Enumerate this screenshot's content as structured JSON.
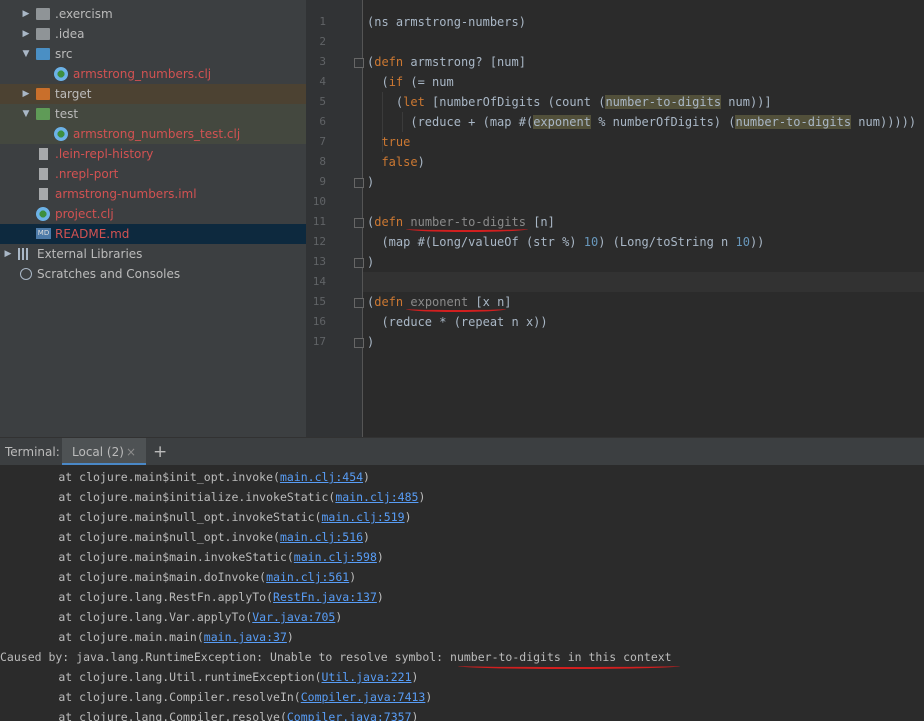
{
  "project_tree": {
    "items": [
      {
        "label": ".exercism",
        "type": "folder",
        "expanded": false
      },
      {
        "label": ".idea",
        "type": "folder",
        "expanded": false
      },
      {
        "label": "src",
        "type": "folder",
        "expanded": true
      },
      {
        "label": "armstrong_numbers.clj",
        "type": "clj"
      },
      {
        "label": "target",
        "type": "folder",
        "expanded": false
      },
      {
        "label": "test",
        "type": "folder",
        "expanded": true
      },
      {
        "label": "armstrong_numbers_test.clj",
        "type": "clj"
      },
      {
        "label": ".lein-repl-history",
        "type": "file"
      },
      {
        "label": ".nrepl-port",
        "type": "file"
      },
      {
        "label": "armstrong-numbers.iml",
        "type": "file"
      },
      {
        "label": "project.clj",
        "type": "clj"
      },
      {
        "label": "README.md",
        "type": "md"
      },
      {
        "label": "External Libraries",
        "type": "libraries"
      },
      {
        "label": "Scratches and Consoles",
        "type": "scratches"
      }
    ]
  },
  "editor": {
    "line_numbers": [
      "1",
      "2",
      "3",
      "4",
      "5",
      "6",
      "7",
      "8",
      "9",
      "10",
      "11",
      "12",
      "13",
      "14",
      "15",
      "16",
      "17"
    ],
    "line1": "(ns armstrong-numbers)",
    "line3": {
      "a": "(",
      "defn": "defn",
      "b": " armstrong? [num]"
    },
    "line4": {
      "a": "(",
      "if": "if",
      "b": " (= num"
    },
    "line5": {
      "a": "(",
      "let": "let",
      "b": " [numberOfDigits (count (",
      "fn": "number-to-digits",
      "c": " num))]"
    },
    "line6": {
      "a": "(reduce + (map #(",
      "fn1": "exponent",
      "b": " % numberOfDigits) (",
      "fn2": "number-to-digits",
      "c": " num)))))"
    },
    "line7": "true",
    "line8": {
      "kw": "false",
      "b": ")"
    },
    "line9": ")",
    "line11": {
      "a": "(",
      "defn": "defn",
      "sp": " ",
      "name": "number-to-digits",
      "b": " [n]"
    },
    "line12": {
      "a": "(map #(Long/valueOf (str %) ",
      "n1": "10",
      "b": ") (Long/toString n ",
      "n2": "10",
      "c": "))"
    },
    "line13": ")",
    "line15": {
      "a": "(",
      "defn": "defn",
      "sp": " ",
      "name": "exponent",
      "b": " [x n]"
    },
    "line16": {
      "a": "(reduce * (repeat n x))"
    },
    "line17": ")"
  },
  "terminal": {
    "title": "Terminal:",
    "tab_label": "Local (2)",
    "close_glyph": "×",
    "add_glyph": "+",
    "lines": [
      {
        "prefix": "        at clojure.main$init_opt.invoke(",
        "link": "main.clj:454",
        "suffix": ")"
      },
      {
        "prefix": "        at clojure.main$initialize.invokeStatic(",
        "link": "main.clj:485",
        "suffix": ")"
      },
      {
        "prefix": "        at clojure.main$null_opt.invokeStatic(",
        "link": "main.clj:519",
        "suffix": ")"
      },
      {
        "prefix": "        at clojure.main$null_opt.invoke(",
        "link": "main.clj:516",
        "suffix": ")"
      },
      {
        "prefix": "        at clojure.main$main.invokeStatic(",
        "link": "main.clj:598",
        "suffix": ")"
      },
      {
        "prefix": "        at clojure.main$main.doInvoke(",
        "link": "main.clj:561",
        "suffix": ")"
      },
      {
        "prefix": "        at clojure.lang.RestFn.applyTo(",
        "link": "RestFn.java:137",
        "suffix": ")"
      },
      {
        "prefix": "        at clojure.lang.Var.applyTo(",
        "link": "Var.java:705",
        "suffix": ")"
      },
      {
        "prefix": "        at clojure.main.main(",
        "link": "main.java:37",
        "suffix": ")"
      },
      {
        "prefix": "Caused by: java.lang.RuntimeException: Unable to resolve symbol: number-to-digits in this context",
        "link": "",
        "suffix": ""
      },
      {
        "prefix": "        at clojure.lang.Util.runtimeException(",
        "link": "Util.java:221",
        "suffix": ")"
      },
      {
        "prefix": "        at clojure.lang.Compiler.resolveIn(",
        "link": "Compiler.java:7413",
        "suffix": ")"
      },
      {
        "prefix": "        at clojure.lang.Compiler.resolve(",
        "link": "Compiler.java:7357",
        "suffix": ")"
      }
    ]
  },
  "colors": {
    "keyword": "#cc7832",
    "number": "#6897bb",
    "link": "#589df6",
    "error_underline": "#d21f1f",
    "selection": "#0d293e"
  }
}
